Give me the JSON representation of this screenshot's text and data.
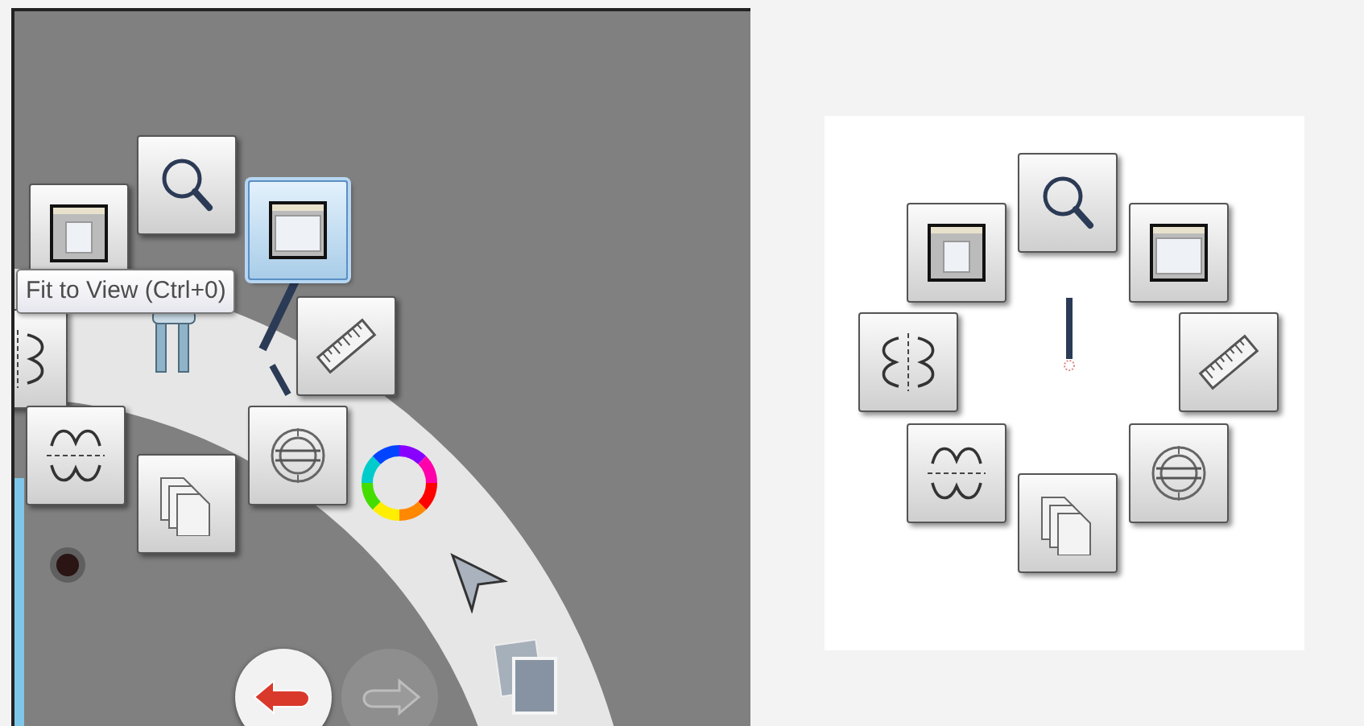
{
  "left_panel": {
    "tool_buttons": [
      {
        "kind": "center-window",
        "selected": false
      },
      {
        "kind": "zoom",
        "selected": false
      },
      {
        "kind": "fit-window",
        "selected": true
      },
      {
        "kind": "mirror-vertical",
        "selected": false
      },
      {
        "kind": "ruler",
        "selected": false
      },
      {
        "kind": "mirror-horizontal",
        "selected": false
      },
      {
        "kind": "pages",
        "selected": false
      },
      {
        "kind": "protractor",
        "selected": false
      }
    ],
    "tooltip": {
      "text": "Fit to View (Ctrl+0)"
    },
    "history_buttons": [
      {
        "kind": "undo",
        "disabled": false
      },
      {
        "kind": "redo",
        "disabled": true
      }
    ]
  },
  "right_panel": {
    "tool_buttons": [
      {
        "kind": "zoom",
        "selected": false
      },
      {
        "kind": "center-window",
        "selected": false
      },
      {
        "kind": "fit-window",
        "selected": false
      },
      {
        "kind": "mirror-vertical",
        "selected": false
      },
      {
        "kind": "ruler",
        "selected": false
      },
      {
        "kind": "mirror-horizontal",
        "selected": false
      },
      {
        "kind": "pages",
        "selected": false
      },
      {
        "kind": "protractor",
        "selected": false
      }
    ]
  }
}
